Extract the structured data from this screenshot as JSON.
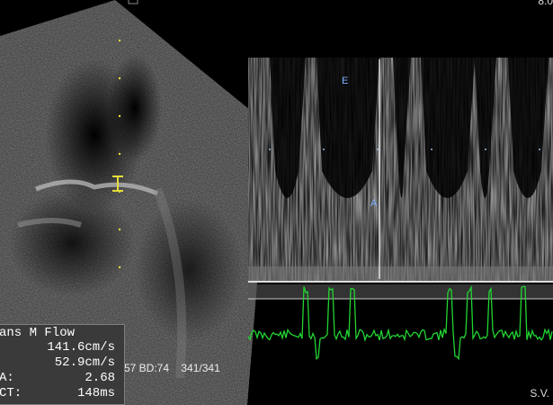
{
  "header": {
    "top_right_value": "8.0"
  },
  "doppler": {
    "e_marker": "E",
    "a_marker": "A"
  },
  "footer": {
    "bottom_info": "57 BD:74    341/341",
    "bottom_right_label": "S.V."
  },
  "measurements": {
    "title": "ans M Flow",
    "rows": [
      {
        "label": "",
        "value": "141.6cm/s"
      },
      {
        "label": "",
        "value": "52.9cm/s"
      },
      {
        "label": "A:",
        "value": "2.68"
      },
      {
        "label": "CT:",
        "value": "148ms"
      }
    ]
  },
  "colors": {
    "ecg": "#22d433",
    "markers": "#7fb2ff",
    "caliper": "#e6dd3a",
    "panel": "#3a3a3a"
  }
}
